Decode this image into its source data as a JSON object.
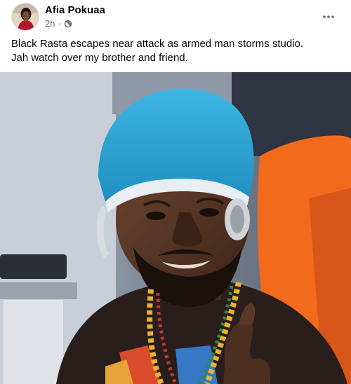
{
  "post": {
    "author": "Afia Pokuaa",
    "time": "2h",
    "separator": "·",
    "audience_icon": "globe-icon",
    "more_icon": "more-options-icon",
    "caption_lines": [
      "Black Rasta escapes near attack as armed man storms studio.",
      "Jah watch over my brother and friend."
    ]
  },
  "colors": {
    "text_primary": "#050505",
    "text_secondary": "#65676b",
    "headwrap": "#2aa7d6",
    "chair": "#f26a1b"
  }
}
